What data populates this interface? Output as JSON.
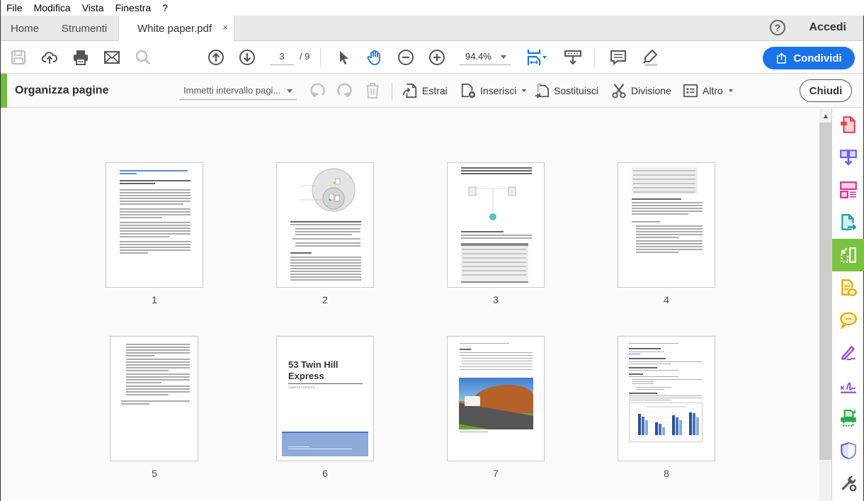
{
  "menu": [
    "File",
    "Modifica",
    "Vista",
    "Finestra",
    "?"
  ],
  "tabs": {
    "home": "Home",
    "tools": "Strumenti",
    "document": "White paper.pdf",
    "close_glyph": "×"
  },
  "header": {
    "help_glyph": "?",
    "signin": "Accedi"
  },
  "toolbar": {
    "icons": [
      "save-icon",
      "upload-cloud-icon",
      "print-icon",
      "email-icon",
      "search-icon",
      "prev-page-icon",
      "next-page-icon",
      "select-arrow-icon",
      "hand-icon",
      "zoom-out-icon",
      "zoom-in-icon",
      "fit-page-icon",
      "scroll-mode-icon",
      "comment-icon",
      "highlight-icon"
    ],
    "page_current": "3",
    "page_total": "/ 9",
    "zoom": "94.4%",
    "share_label": "Condividi"
  },
  "organize": {
    "title": "Organizza pagine",
    "range_placeholder": "Immetti intervallo pagi...",
    "actions": {
      "extract": "Estrai",
      "insert": "Inserisci",
      "replace": "Sostituisci",
      "split": "Divisione",
      "more": "Altro"
    },
    "close_label": "Chiudi"
  },
  "pages": [
    {
      "number": "1",
      "title": "Electronic and digital signatures in Adobe Sign for government white paper"
    },
    {
      "number": "2",
      "title": ""
    },
    {
      "number": "3",
      "title": "Signature types in Adobe Sign"
    },
    {
      "number": "4",
      "title": ""
    },
    {
      "number": "5",
      "title": ""
    },
    {
      "number": "6",
      "title": "53 Twin Hill Express",
      "subtitle": "CAMPUS EXPRESS"
    },
    {
      "number": "7",
      "title": "Contents"
    },
    {
      "number": "8",
      "title": "Campus Express (Route 53)"
    }
  ],
  "rail": {
    "items": [
      "create-pdf-icon",
      "combine-files-icon",
      "edit-pdf-icon",
      "export-pdf-icon",
      "organize-pages-icon",
      "send-for-comments-icon",
      "comment-icon",
      "fill-sign-icon",
      "request-signature-icon",
      "print-production-icon",
      "protect-icon",
      "more-tools-icon"
    ],
    "active": "organize-pages-icon"
  },
  "colors": {
    "accent_green": "#7cc242",
    "share_blue": "#1a73e8"
  }
}
